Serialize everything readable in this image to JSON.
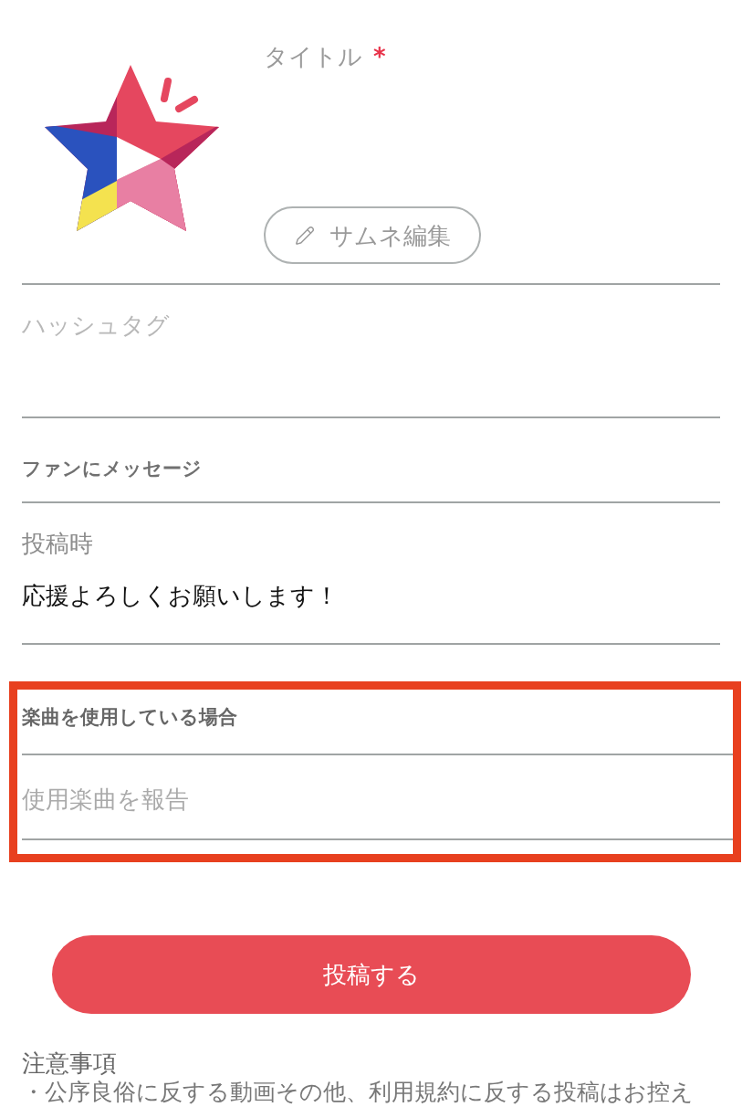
{
  "title_field": {
    "label": "タイトル",
    "required_mark": "*"
  },
  "thumbnail_button": {
    "label": "サムネ編集"
  },
  "hashtag_field": {
    "placeholder": "ハッシュタグ"
  },
  "fan_message": {
    "heading": "ファンにメッセージ",
    "label": "投稿時",
    "value": "応援よろしくお願いします！"
  },
  "music_section": {
    "highlighted": true,
    "heading": "楽曲を使用している場合",
    "report_field": {
      "placeholder": "使用楽曲を報告"
    }
  },
  "submit_button": {
    "label": "投稿する"
  },
  "notes": {
    "heading": "注意事項",
    "items": [
      "・公序良俗に反する動画その他、利用規約に反する投稿はお控え"
    ]
  }
}
